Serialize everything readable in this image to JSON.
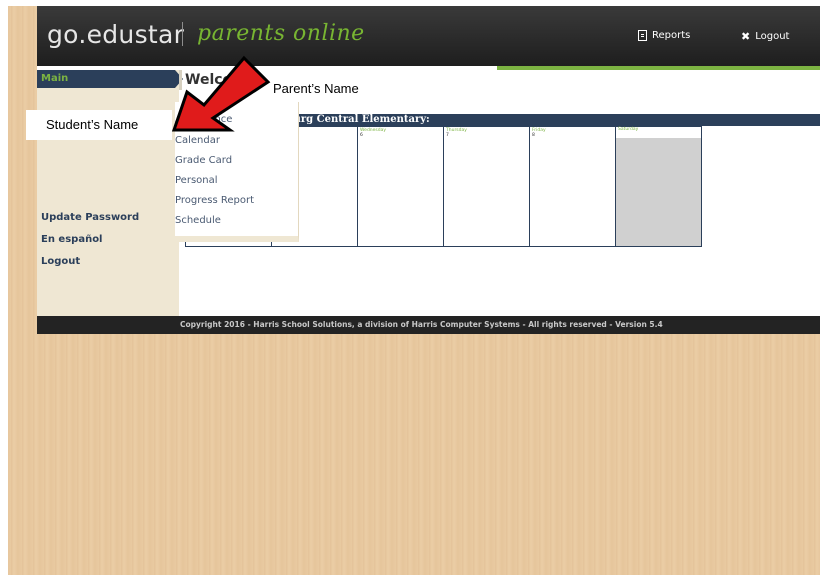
{
  "header": {
    "logo": "go.edustar",
    "logo_sub": "parents online",
    "reports_label": "Reports",
    "logout_label": "Logout",
    "icons": {
      "reports": "document-icon",
      "logout": "x-icon"
    }
  },
  "sidebar": {
    "main_label": "Main",
    "links": [
      "Update Password",
      "En español",
      "Logout"
    ]
  },
  "welcome": "Welcome",
  "student_menu": {
    "items": [
      "Attendance",
      "Calendar",
      "Grade Card",
      "Personal",
      "Progress Report",
      "Schedule"
    ]
  },
  "calendar": {
    "school_title": "sburg Central Elementary:",
    "days": [
      {
        "name": "",
        "num": ""
      },
      {
        "name": "",
        "num": ""
      },
      {
        "name": "Wednesday",
        "num": "6"
      },
      {
        "name": "Thursday",
        "num": "7"
      },
      {
        "name": "Friday",
        "num": "8"
      },
      {
        "name": "Saturday",
        "num": ""
      }
    ]
  },
  "footer": "Copyright 2016 - Harris School Solutions, a division of Harris Computer Systems - All rights reserved - Version 5.4",
  "annotations": {
    "parent": "Parent’s Name",
    "student": "Student’s Name"
  },
  "colors": {
    "header_bg": "#1e1e1e",
    "accent_green": "#78b532",
    "navy": "#2b3f5a",
    "sidebar_bg": "#efe7d3",
    "arrow_red": "#e01b1b",
    "saturday_gray": "#d0d0d0"
  }
}
